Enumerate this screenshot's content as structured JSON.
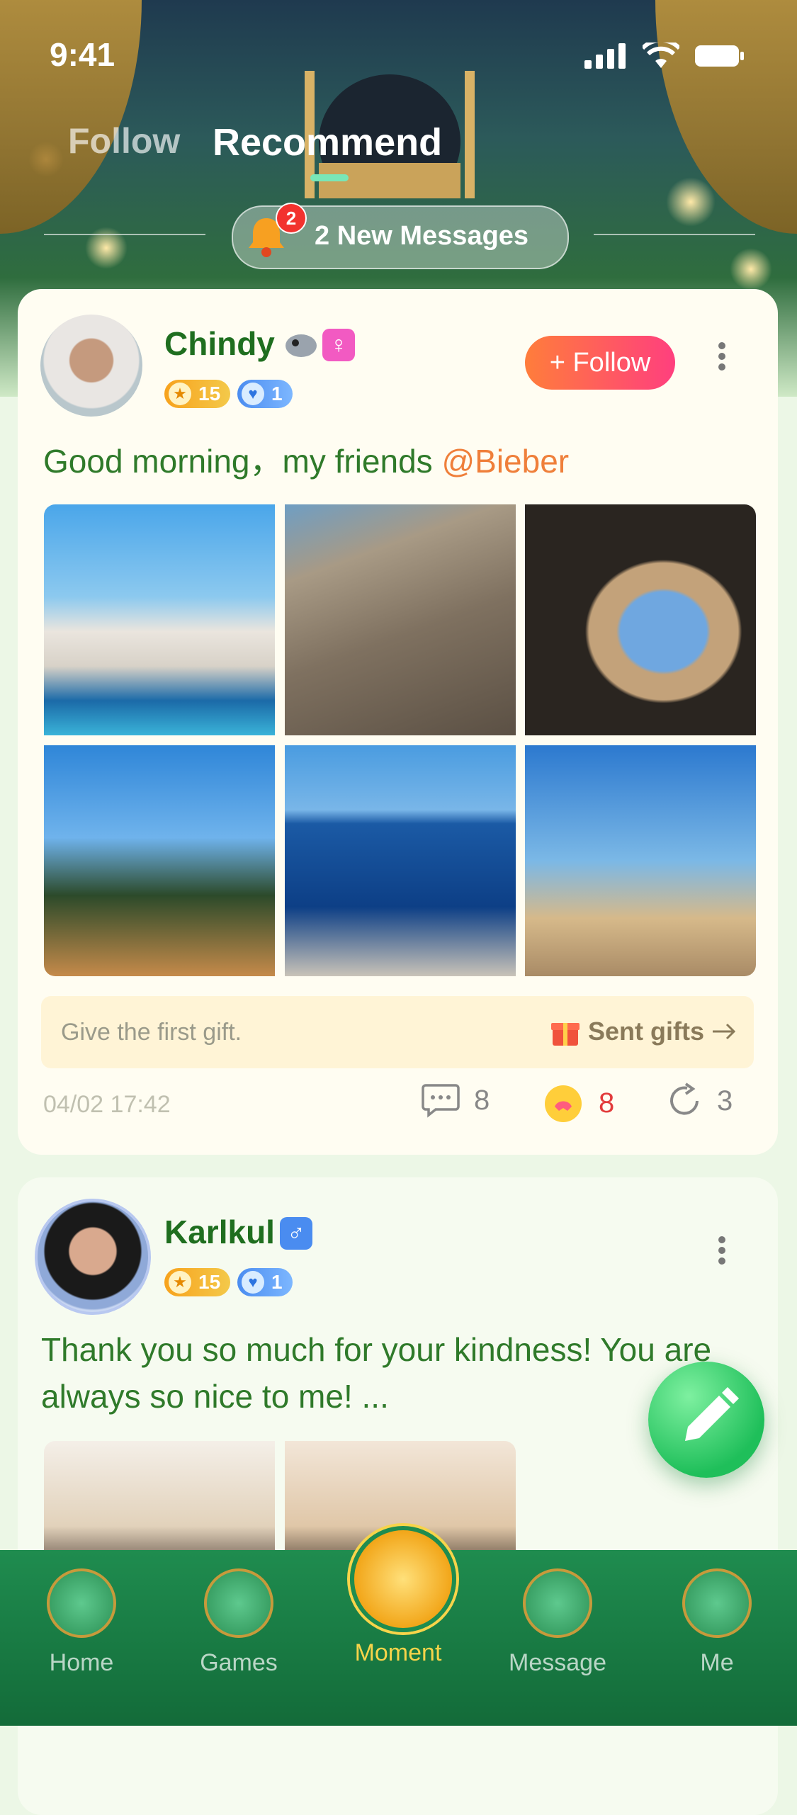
{
  "status_bar": {
    "time": "9:41"
  },
  "top_tabs": [
    {
      "label": "Follow"
    },
    {
      "label": "Recommend"
    }
  ],
  "new_messages": {
    "count": "2",
    "label": "2 New Messages"
  },
  "posts": [
    {
      "username": "Chindy",
      "gender": "♀",
      "level_star": "15",
      "level_heart": "1",
      "follow_label": "+ Follow",
      "text": "Good morning，my friends ",
      "mention": "@Bieber",
      "gift_prompt": "Give the first gift.",
      "sent_gifts_label": "Sent gifts",
      "date": "04/02 17:42",
      "comments": "8",
      "reactions": "8",
      "shares": "3"
    },
    {
      "username": "Karlkul",
      "gender": "♂",
      "level_star": "15",
      "level_heart": "1",
      "text": "Thank you so much for your kindness! You are always so nice to me! ..."
    }
  ],
  "bottom_nav": [
    {
      "label": "Home"
    },
    {
      "label": "Games"
    },
    {
      "label": "Moment"
    },
    {
      "label": "Message"
    },
    {
      "label": "Me"
    }
  ],
  "colors": {
    "accent_green": "#1f6e1f",
    "mention": "#ef7f3a",
    "follow_gradient_start": "#ff7d3b",
    "follow_gradient_end": "#ff3f7e",
    "nav_active": "#f7d44a"
  }
}
